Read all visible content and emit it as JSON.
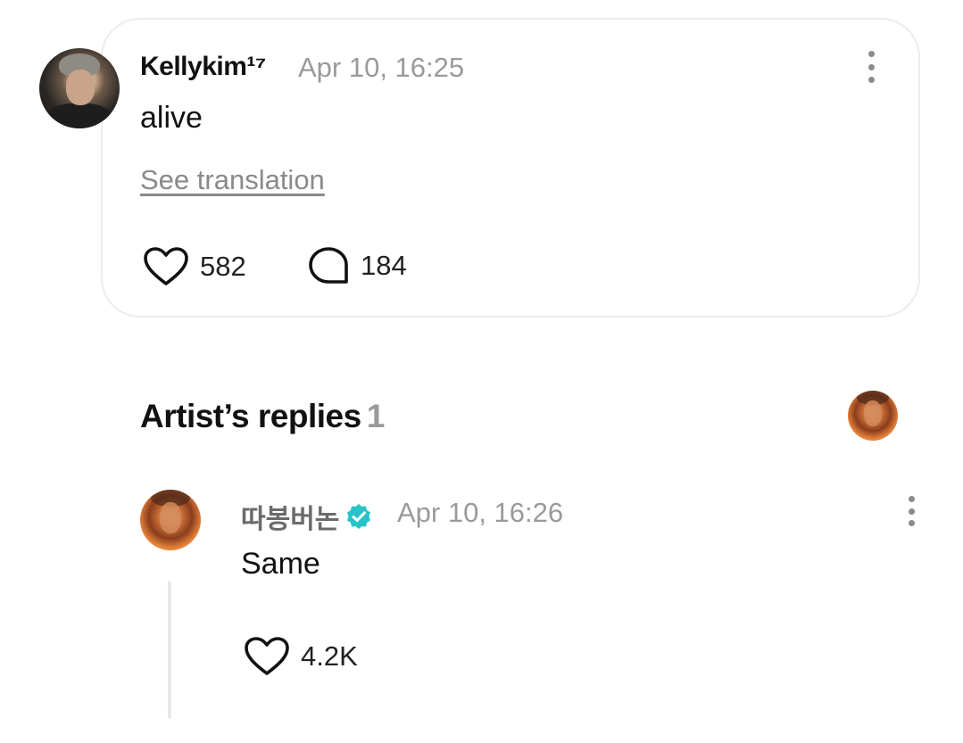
{
  "post": {
    "author": {
      "name": "Kellykim¹⁷",
      "avatar_icon": "user-avatar"
    },
    "timestamp": "Apr 10, 16:25",
    "body": "alive",
    "see_translation": "See translation",
    "likes": "582",
    "comments": "184",
    "icons": {
      "like": "heart-outline-icon",
      "comment": "speech-bubble-outline-icon",
      "more": "vertical-dots-icon"
    }
  },
  "artist_replies": {
    "heading": "Artist’s replies",
    "count": "1",
    "replies": [
      {
        "author": "따봉버논",
        "verified": true,
        "verified_color": "#27c3c8",
        "timestamp": "Apr 10, 16:26",
        "body": "Same",
        "likes": "4.2K"
      }
    ]
  },
  "colors": {
    "text": "#111111",
    "muted": "#9a9a9a",
    "card_border": "#ececec",
    "thread_line": "#e8e8e8",
    "verified": "#27c3c8"
  }
}
